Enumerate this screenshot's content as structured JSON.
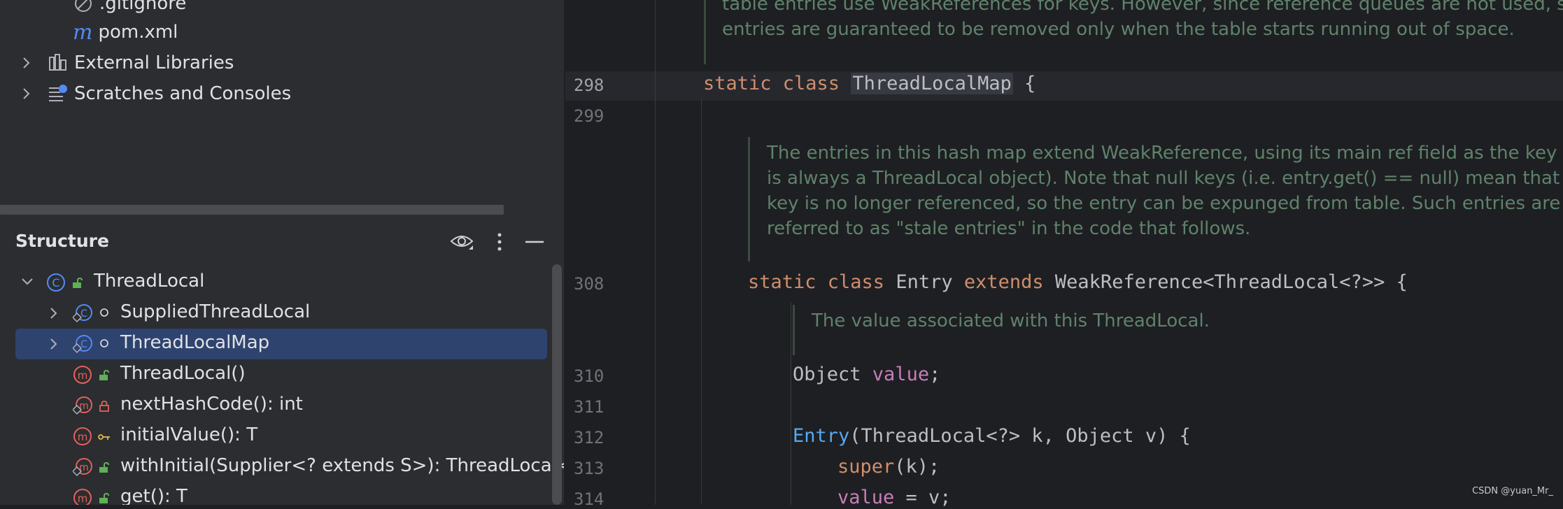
{
  "project_tree": {
    "items": [
      {
        "label": ".gitignore",
        "icon": "gitignore-icon"
      },
      {
        "label": "pom.xml",
        "icon": "maven-icon"
      },
      {
        "label": "External Libraries",
        "icon": "libraries-icon"
      },
      {
        "label": "Scratches and Consoles",
        "icon": "scratches-icon"
      }
    ]
  },
  "structure": {
    "title": "Structure",
    "items": [
      {
        "label": "ThreadLocal"
      },
      {
        "label": "SuppliedThreadLocal"
      },
      {
        "label": "ThreadLocalMap"
      },
      {
        "label": "ThreadLocal()"
      },
      {
        "label": "nextHashCode(): int"
      },
      {
        "label": "initialValue(): T"
      },
      {
        "label": "withInitial(Supplier<? extends S>): ThreadLocal<S>"
      },
      {
        "label": "get(): T"
      }
    ]
  },
  "editor": {
    "line_numbers": [
      "298",
      "299",
      "308",
      "310",
      "311",
      "312",
      "313",
      "314"
    ],
    "doc_top": [
      "table entries use WeakReferences for keys. However, since reference queues are not used, stale",
      "entries are guaranteed to be removed only when the table starts running out of space."
    ],
    "doc_map": [
      "The entries in this hash map extend WeakReference, using its main ref field as the key (which",
      "is always a ThreadLocal object). Note that null keys (i.e. entry.get() == null) mean that the",
      "key is no longer referenced, so the entry can be expunged from table. Such entries are",
      "referred to as \"stale entries\" in the code that follows."
    ],
    "doc_value": "The value associated with this ThreadLocal.",
    "code": {
      "l298_kw": "static class ",
      "l298_name": "ThreadLocalMap",
      "l298_rest": " {",
      "l308_kw1": "static class ",
      "l308_name": "Entry ",
      "l308_kw2": "extends ",
      "l308_rest": "WeakReference<ThreadLocal<?>> {",
      "l310_type": "Object ",
      "l310_field": "value",
      "l310_rest": ";",
      "l312_fn": "Entry",
      "l312_rest": "(ThreadLocal<?> k, Object v) {",
      "l313_kw": "super",
      "l313_rest": "(k);",
      "l314_field": "value",
      "l314_rest": " = v;"
    }
  },
  "watermark": "CSDN @yuan_Mr_",
  "colors": {
    "panel_bg": "#2b2d30",
    "editor_bg": "#1e1f22",
    "keyword": "#cf8e6d",
    "field": "#c77dbb",
    "function": "#56a8f5",
    "doc": "#5f826b",
    "selection": "#2e436e"
  }
}
